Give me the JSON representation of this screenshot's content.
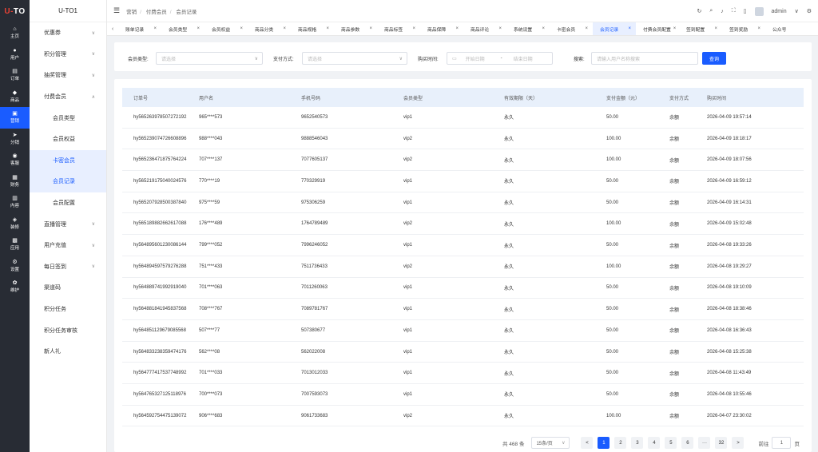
{
  "app": {
    "logo_left": "U-",
    "logo_right": "TO",
    "title": "U-TO1"
  },
  "rail": [
    {
      "label": "主页",
      "icon": "home-icon"
    },
    {
      "label": "用户",
      "icon": "user-icon"
    },
    {
      "label": "订单",
      "icon": "order-icon"
    },
    {
      "label": "商品",
      "icon": "goods-icon"
    },
    {
      "label": "营销",
      "icon": "marketing-icon"
    },
    {
      "label": "分销",
      "icon": "distribution-icon"
    },
    {
      "label": "客服",
      "icon": "service-icon"
    },
    {
      "label": "财务",
      "icon": "finance-icon"
    },
    {
      "label": "内容",
      "icon": "content-icon"
    },
    {
      "label": "装修",
      "icon": "decorate-icon"
    },
    {
      "label": "应用",
      "icon": "app-icon"
    },
    {
      "label": "设置",
      "icon": "settings-icon"
    },
    {
      "label": "维护",
      "icon": "maintenance-icon"
    }
  ],
  "sidebar": [
    {
      "label": "优惠券",
      "chevron": "∨"
    },
    {
      "label": "积分管理",
      "chevron": "∨"
    },
    {
      "label": "抽奖管理",
      "chevron": "∨"
    },
    {
      "label": "付费会员",
      "chevron": "∧"
    },
    {
      "label": "会员类型",
      "sub": true
    },
    {
      "label": "会员权益",
      "sub": true
    },
    {
      "label": "卡密会员",
      "sub": true,
      "highlight": true
    },
    {
      "label": "会员记录",
      "sub": true,
      "highlight": true
    },
    {
      "label": "会员配置",
      "sub": true
    },
    {
      "label": "直播管理",
      "chevron": "∨"
    },
    {
      "label": "用户充值",
      "chevron": "∨"
    },
    {
      "label": "每日签到",
      "chevron": "∨"
    },
    {
      "label": "渠道码"
    },
    {
      "label": "积分任务"
    },
    {
      "label": "积分任务审核"
    },
    {
      "label": "新人礼"
    }
  ],
  "header": {
    "breadcrumb": [
      "营销",
      "付费会员",
      "会员记录"
    ],
    "user": "admin"
  },
  "tabs": [
    "账单记录",
    "会员类型",
    "会员权益",
    "商品分类",
    "商品规格",
    "商品参数",
    "商品标签",
    "商品保障",
    "商品评论",
    "系统设置",
    "卡密会员",
    "会员记录",
    "付费会员配置",
    "签到配置",
    "签到奖励",
    "公众号"
  ],
  "active_tab": 11,
  "filter": {
    "type_label": "会员类型:",
    "type_placeholder": "请选择",
    "pay_label": "支付方式:",
    "pay_placeholder": "请选择",
    "time_label": "购买时间:",
    "start_placeholder": "开始日期",
    "range_sep": "-",
    "end_placeholder": "结束日期",
    "search_label": "搜索:",
    "search_placeholder": "请输入用户名称搜索",
    "query_button": "查询"
  },
  "table": {
    "headers": [
      "订单号",
      "用户名",
      "手机号码",
      "会员类型",
      "有效期限（天）",
      "支付金额（元）",
      "支付方式",
      "购买时间"
    ],
    "rows": [
      [
        "hy565263978507272192",
        "965****573",
        "9652540573",
        "vip1",
        "永久",
        "50.00",
        "余额",
        "2026-04-09 19:57:14"
      ],
      [
        "hy565239074726608896",
        "988****043",
        "9888546043",
        "vip2",
        "永久",
        "100.00",
        "余额",
        "2026-04-09 18:18:17"
      ],
      [
        "hy565236471875764224",
        "707****137",
        "7077605137",
        "vip2",
        "永久",
        "100.00",
        "余额",
        "2026-04-09 18:07:56"
      ],
      [
        "hy565219175040024576",
        "770****19",
        "770329919",
        "vip1",
        "永久",
        "50.00",
        "余额",
        "2026-04-09 16:59:12"
      ],
      [
        "hy565207928500387840",
        "975****59",
        "975306259",
        "vip1",
        "永久",
        "50.00",
        "余额",
        "2026-04-09 16:14:31"
      ],
      [
        "hy565189882662617088",
        "176****489",
        "1764789489",
        "vip2",
        "永久",
        "100.00",
        "余额",
        "2026-04-09 15:02:48"
      ],
      [
        "hy564895601230086144",
        "799****052",
        "7996246052",
        "vip1",
        "永久",
        "50.00",
        "余额",
        "2026-04-08 19:33:26"
      ],
      [
        "hy564894597579276288",
        "751****433",
        "7511736433",
        "vip2",
        "永久",
        "100.00",
        "余额",
        "2026-04-08 19:29:27"
      ],
      [
        "hy564889741992919040",
        "701****063",
        "7011260063",
        "vip1",
        "永久",
        "50.00",
        "余额",
        "2026-04-08 19:10:09"
      ],
      [
        "hy564881841945837568",
        "708****767",
        "7089781767",
        "vip1",
        "永久",
        "50.00",
        "余额",
        "2026-04-08 18:38:46"
      ],
      [
        "hy564851129679085568",
        "507****77",
        "507380677",
        "vip1",
        "永久",
        "50.00",
        "余额",
        "2026-04-08 16:36:43"
      ],
      [
        "hy564833238359474176",
        "562****08",
        "562022008",
        "vip1",
        "永久",
        "50.00",
        "余额",
        "2026-04-08 15:25:38"
      ],
      [
        "hy564777417537748992",
        "701****033",
        "7013012033",
        "vip1",
        "永久",
        "50.00",
        "余额",
        "2026-04-08 11:43:49"
      ],
      [
        "hy564765327125118976",
        "700****073",
        "7007593073",
        "vip1",
        "永久",
        "50.00",
        "余额",
        "2026-04-08 10:55:46"
      ],
      [
        "hy564592754475139072",
        "906****683",
        "9061733683",
        "vip2",
        "永久",
        "100.00",
        "余额",
        "2026-04-07 23:30:02"
      ]
    ]
  },
  "pagination": {
    "total": "共 468 条",
    "page_size": "15条/页",
    "prev": "<",
    "pages": [
      "1",
      "2",
      "3",
      "4",
      "5",
      "6",
      "···",
      "32"
    ],
    "current": "1",
    "next": ">",
    "goto_label": "前往",
    "goto_value": "1",
    "goto_suffix": "页"
  }
}
